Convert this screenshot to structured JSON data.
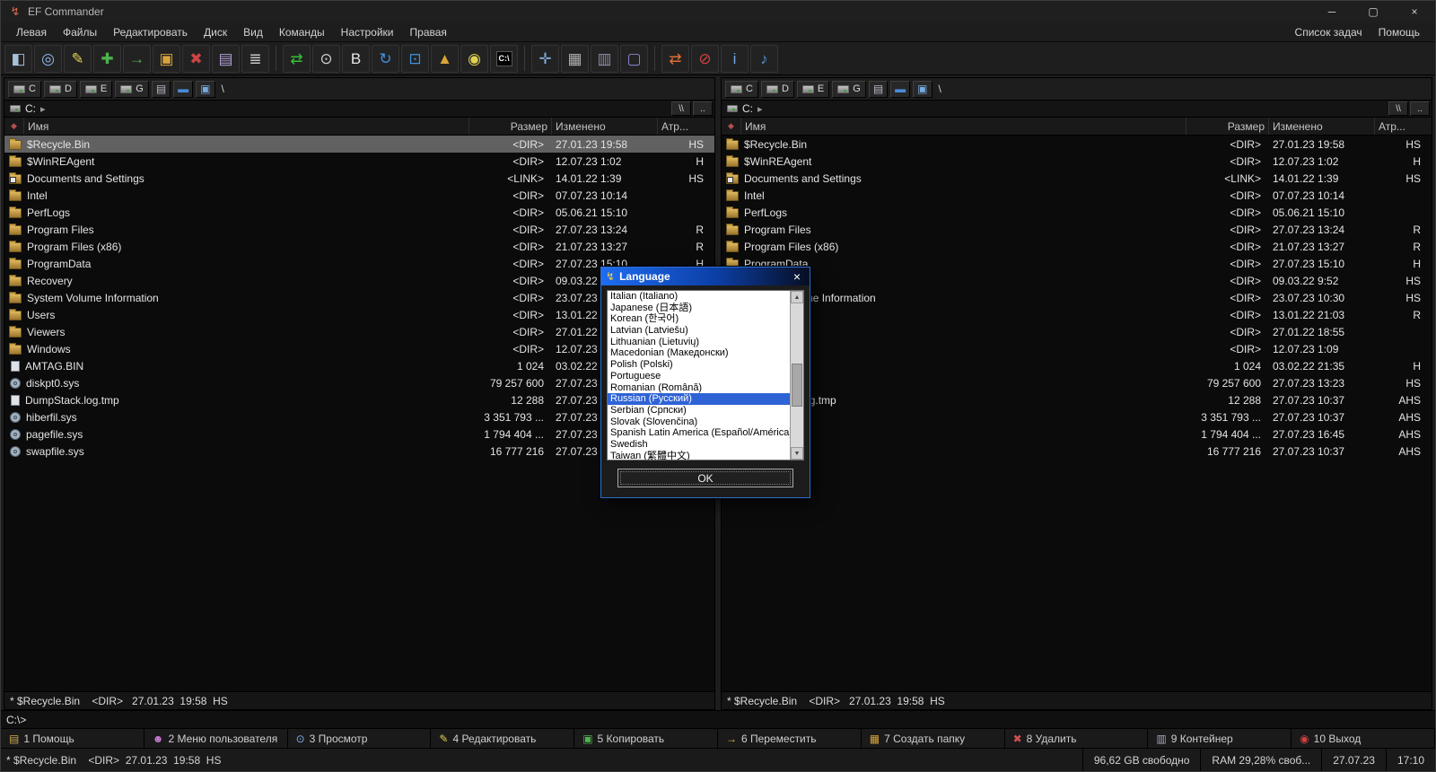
{
  "window": {
    "title": "EF Commander",
    "icon_glyph": "↯",
    "minimize_glyph": "─",
    "maximize_glyph": "▢",
    "close_glyph": "×"
  },
  "menu": {
    "left": [
      {
        "name": "left",
        "label": "Левая"
      },
      {
        "name": "files",
        "label": "Файлы"
      },
      {
        "name": "edit",
        "label": "Редактировать"
      },
      {
        "name": "disk",
        "label": "Диск"
      },
      {
        "name": "view",
        "label": "Вид"
      },
      {
        "name": "commands",
        "label": "Команды"
      },
      {
        "name": "settings",
        "label": "Настройки"
      },
      {
        "name": "right",
        "label": "Правая"
      }
    ],
    "right": [
      {
        "name": "task-list",
        "label": "Список задач"
      },
      {
        "name": "help",
        "label": "Помощь"
      }
    ]
  },
  "toolbar": {
    "groups": [
      [
        {
          "name": "new-tab",
          "glyph": "◧",
          "color": "#a8c0d8"
        },
        {
          "name": "quick-view",
          "glyph": "◎",
          "color": "#8fb8e8"
        },
        {
          "name": "edit-file",
          "glyph": "✎",
          "color": "#e0d050"
        },
        {
          "name": "copy",
          "glyph": "✚",
          "color": "#4db34d"
        },
        {
          "name": "move",
          "glyph": "→",
          "color": "#4db34d"
        },
        {
          "name": "new-folder",
          "glyph": "▣",
          "color": "#d8a43a"
        },
        {
          "name": "delete",
          "glyph": "✖",
          "color": "#cc4444"
        },
        {
          "name": "pack",
          "glyph": "▤",
          "color": "#b0a0d8"
        },
        {
          "name": "multi-rename",
          "glyph": "≣",
          "color": "#c8c8c8"
        }
      ],
      [
        {
          "name": "refresh",
          "glyph": "⇄",
          "color": "#35c035"
        },
        {
          "name": "search",
          "glyph": "⊙",
          "color": "#d0d0d0"
        },
        {
          "name": "hex-view",
          "glyph": "B",
          "color": "#e8e8e8"
        },
        {
          "name": "sync",
          "glyph": "↻",
          "color": "#4090e0"
        },
        {
          "name": "find-window",
          "glyph": "⊡",
          "color": "#4090e0"
        },
        {
          "name": "ftp",
          "glyph": "▲",
          "color": "#d8a43a"
        },
        {
          "name": "search-files",
          "glyph": "◉",
          "color": "#e0d050"
        },
        {
          "name": "console",
          "glyph": "C:\\",
          "color": "#ffffff",
          "bg": "#000000"
        }
      ],
      [
        {
          "name": "settings-tool",
          "glyph": "✛",
          "color": "#80b0e0"
        },
        {
          "name": "print",
          "glyph": "▦",
          "color": "#b0b0b0"
        },
        {
          "name": "recycle-bin",
          "glyph": "▥",
          "color": "#9090a8"
        },
        {
          "name": "display",
          "glyph": "▢",
          "color": "#8888d0"
        }
      ],
      [
        {
          "name": "connect",
          "glyph": "⇄",
          "color": "#e07030"
        },
        {
          "name": "disconnect",
          "glyph": "⊘",
          "color": "#d04040"
        },
        {
          "name": "info",
          "glyph": "i",
          "color": "#70a8e0"
        },
        {
          "name": "media-search",
          "glyph": "♪",
          "color": "#5090d0"
        }
      ]
    ]
  },
  "drivebar": {
    "drives": [
      "C",
      "D",
      "E",
      "G"
    ],
    "extras": [
      {
        "name": "removable-drive",
        "glyph": "▤",
        "color": "#b8b8c8"
      },
      {
        "name": "desktop",
        "glyph": "▬",
        "color": "#4a8ad8"
      },
      {
        "name": "network",
        "glyph": "▣",
        "color": "#78aade"
      }
    ],
    "path_label": "\\"
  },
  "pathbar": {
    "drive": "C:",
    "crumb": "▸",
    "root_button": "\\\\",
    "up_button": ".."
  },
  "columns": {
    "icon": "◆",
    "name": "Имя",
    "size": "Размер",
    "changed": "Изменено",
    "attr": "Атр..."
  },
  "cursor_row": 0,
  "files": [
    {
      "icon": "folder",
      "name": "$Recycle.Bin",
      "size": "<DIR>",
      "changed": "27.01.23 19:58",
      "attr": "HS"
    },
    {
      "icon": "folder",
      "name": "$WinREAgent",
      "size": "<DIR>",
      "changed": "12.07.23 1:02",
      "attr": "H"
    },
    {
      "icon": "folder-link",
      "name": "Documents and Settings",
      "size": "<LINK>",
      "changed": "14.01.22 1:39",
      "attr": "HS"
    },
    {
      "icon": "folder",
      "name": "Intel",
      "size": "<DIR>",
      "changed": "07.07.23 10:14",
      "attr": ""
    },
    {
      "icon": "folder",
      "name": "PerfLogs",
      "size": "<DIR>",
      "changed": "05.06.21 15:10",
      "attr": ""
    },
    {
      "icon": "folder",
      "name": "Program Files",
      "size": "<DIR>",
      "changed": "27.07.23 13:24",
      "attr": "R"
    },
    {
      "icon": "folder",
      "name": "Program Files (x86)",
      "size": "<DIR>",
      "changed": "21.07.23 13:27",
      "attr": "R"
    },
    {
      "icon": "folder",
      "name": "ProgramData",
      "size": "<DIR>",
      "changed": "27.07.23 15:10",
      "attr": "H"
    },
    {
      "icon": "folder",
      "name": "Recovery",
      "size": "<DIR>",
      "changed": "09.03.22 9:52",
      "attr": "HS"
    },
    {
      "icon": "folder",
      "name": "System Volume Information",
      "size": "<DIR>",
      "changed": "23.07.23 10:30",
      "attr": "HS"
    },
    {
      "icon": "folder",
      "name": "Users",
      "size": "<DIR>",
      "changed": "13.01.22 21:03",
      "attr": "R"
    },
    {
      "icon": "folder",
      "name": "Viewers",
      "size": "<DIR>",
      "changed": "27.01.22 18:55",
      "attr": ""
    },
    {
      "icon": "folder",
      "name": "Windows",
      "size": "<DIR>",
      "changed": "12.07.23 1:09",
      "attr": ""
    },
    {
      "icon": "file",
      "name": "AMTAG.BIN",
      "size": "1 024",
      "changed": "03.02.22 21:35",
      "attr": "H"
    },
    {
      "icon": "sys",
      "name": "diskpt0.sys",
      "size": "79 257 600",
      "changed": "27.07.23 13:23",
      "attr": "HS"
    },
    {
      "icon": "file",
      "name": "DumpStack.log.tmp",
      "size": "12 288",
      "changed": "27.07.23 10:37",
      "attr": "AHS"
    },
    {
      "icon": "sys",
      "name": "hiberfil.sys",
      "size": "3 351 793 ...",
      "changed": "27.07.23 10:37",
      "attr": "AHS"
    },
    {
      "icon": "sys",
      "name": "pagefile.sys",
      "size": "1 794 404 ...",
      "changed": "27.07.23 16:45",
      "attr": "AHS"
    },
    {
      "icon": "sys",
      "name": "swapfile.sys",
      "size": "16 777 216",
      "changed": "27.07.23 10:37",
      "attr": "AHS"
    }
  ],
  "panel_status": "* $Recycle.Bin    <DIR>   27.01.23  19:58  HS",
  "dialog": {
    "title": "Language",
    "icon_glyph": "↯",
    "close_glyph": "×",
    "scroll_up_glyph": "▲",
    "scroll_down_glyph": "▼",
    "languages": [
      "Italian (Italiano)",
      "Japanese (日本語)",
      "Korean (한국어)",
      "Latvian (Latviešu)",
      "Lithuanian (Lietuvių)",
      "Macedonian (Македонски)",
      "Polish (Polski)",
      "Portuguese",
      "Romanian (Română)",
      "Russian (Русский)",
      "Serbian (Српски)",
      "Slovak (Slovenčina)",
      "Spanish Latin America (Español/América)",
      "Swedish",
      "Taiwan (繁體中文)"
    ],
    "selected_index": 9,
    "ok_label": "OK"
  },
  "cmdline": "C:\\>",
  "function_keys": [
    {
      "name": "help",
      "label": "1 Помощь",
      "glyph": "▤",
      "color": "#caa952"
    },
    {
      "name": "user-menu",
      "label": "2 Меню пользователя",
      "glyph": "☻",
      "color": "#c87ad2"
    },
    {
      "name": "view",
      "label": "3 Просмотр",
      "glyph": "⊙",
      "color": "#7ab0e8"
    },
    {
      "name": "edit",
      "label": "4 Редактировать",
      "glyph": "✎",
      "color": "#e0d050"
    },
    {
      "name": "copy",
      "label": "5 Копировать",
      "glyph": "▣",
      "color": "#52b052"
    },
    {
      "name": "move",
      "label": "6 Переместить",
      "glyph": "→",
      "color": "#e0c040"
    },
    {
      "name": "new-folder",
      "label": "7 Создать папку",
      "glyph": "▦",
      "color": "#d8a43a"
    },
    {
      "name": "delete",
      "label": "8 Удалить",
      "glyph": "✖",
      "color": "#d05050"
    },
    {
      "name": "container",
      "label": "9 Контейнер",
      "glyph": "▥",
      "color": "#a8a8c0"
    },
    {
      "name": "exit",
      "label": "10 Выход",
      "glyph": "◉",
      "color": "#d04040"
    }
  ],
  "statusbar": {
    "left": "* $Recycle.Bin    <DIR>  27.01.23  19:58  HS",
    "cells": [
      {
        "name": "free-space-status",
        "text": "96,62 GB свободно"
      },
      {
        "name": "ram-status",
        "text": "RAM 29,28% своб..."
      },
      {
        "name": "date-status",
        "text": "27.07.23"
      },
      {
        "name": "time-status",
        "text": "17:10"
      }
    ]
  }
}
